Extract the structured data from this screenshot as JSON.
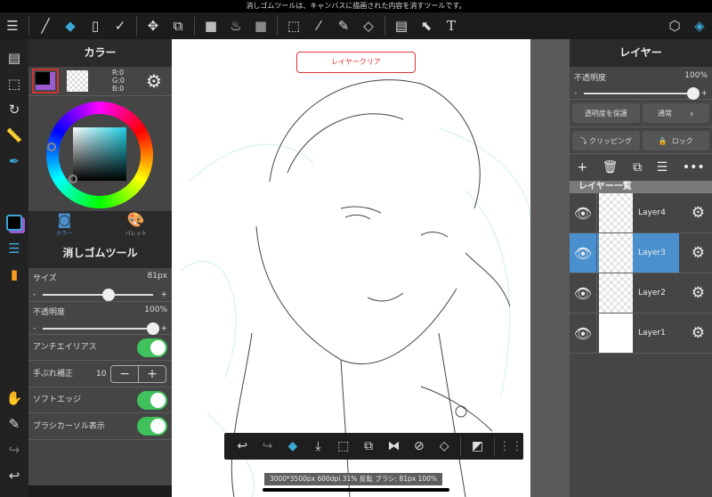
{
  "message": "消しゴムツールは、キャンバスに描画された内容を消すツールです。",
  "toolbar": {
    "icons": [
      "menu-icon",
      "brush-icon",
      "eraser-icon",
      "rectangle-icon",
      "correction-icon",
      "move-icon",
      "transform-icon",
      "fill-color-icon",
      "bucket-icon",
      "gradient-icon",
      "select-rect-icon",
      "magic-wand-icon",
      "select-pen-icon",
      "select-eraser-icon",
      "frame-icon",
      "select-layer-icon",
      "text-icon",
      "3d-material-icon",
      "layers-icon"
    ],
    "text_glyph": "T"
  },
  "color_panel": {
    "title": "カラー",
    "rgb": {
      "r": "R:0",
      "g": "G:0",
      "b": "B:0"
    },
    "tabs": [
      {
        "label": "カラー",
        "active": true
      },
      {
        "label": "パレット",
        "active": false
      }
    ],
    "hue_color": "#1ed0e6"
  },
  "eraser_panel": {
    "title": "消しゴムツール",
    "size_label": "サイズ",
    "size_value": "81px",
    "size_fraction": 0.59,
    "opacity_label": "不透明度",
    "opacity_value": "100%",
    "opacity_fraction": 1.0,
    "minus": "-",
    "plus": "+",
    "antialias_label": "アンチエイリアス",
    "antialias_on": true,
    "stabilizer_label": "手ぶれ補正",
    "stabilizer_value": "10",
    "soft_edge_label": "ソフトエッジ",
    "soft_edge_on": true,
    "cursor_label": "ブラシカーソル表示",
    "cursor_on": true
  },
  "canvas": {
    "clear_button": "レイヤークリア"
  },
  "layer_panel": {
    "title": "レイヤー",
    "opacity_label": "不透明度",
    "opacity_value": "100%",
    "opacity_fraction": 1.0,
    "minus": "-",
    "plus": "+",
    "protect_alpha": "透明度を保護",
    "blend_mode": "通常",
    "clipping": "クリッピング",
    "lock": "ロック",
    "list_header": "レイヤー一覧",
    "layers": [
      {
        "name": "Layer4",
        "selected": false
      },
      {
        "name": "Layer3",
        "selected": true
      },
      {
        "name": "Layer2",
        "selected": false
      },
      {
        "name": "Layer1",
        "selected": false
      }
    ],
    "selected_color": "#4a90cf"
  },
  "bottom_toolbar": {
    "icons": [
      "undo-icon",
      "redo-icon",
      "eraser-transform-icon",
      "import-icon",
      "selection-icon",
      "transform-icon",
      "flip-icon",
      "rotate-reset-icon",
      "clear-icon",
      "snap-icon",
      "grid-menu-icon"
    ]
  },
  "status": "3000*3500px 600dpi 31% 反転 ブラシ: 81px 100%"
}
